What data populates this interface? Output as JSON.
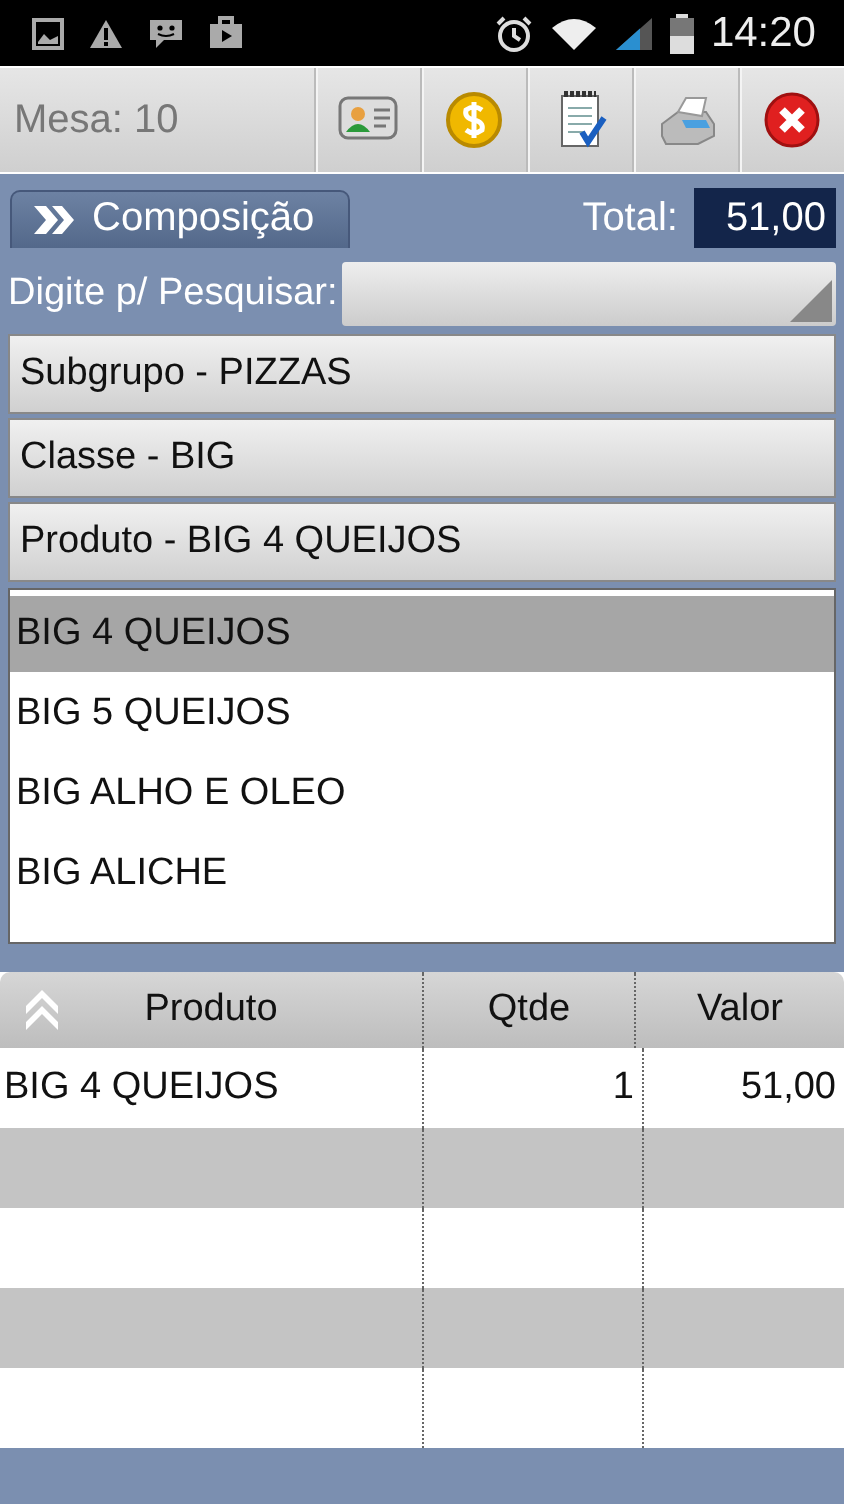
{
  "status_bar": {
    "time": "14:20"
  },
  "toolbar": {
    "title": "Mesa: 10"
  },
  "tab": {
    "label": "Composição",
    "selected": true
  },
  "total": {
    "label": "Total:",
    "value": "51,00"
  },
  "search": {
    "label": "Digite p/ Pesquisar:"
  },
  "filters": [
    {
      "label": "Subgrupo - PIZZAS"
    },
    {
      "label": "Classe - BIG"
    },
    {
      "label": "Produto - BIG 4 QUEIJOS"
    }
  ],
  "products": [
    {
      "label": "BIG 4 QUEIJOS",
      "selected": true
    },
    {
      "label": "BIG 5 QUEIJOS",
      "selected": false
    },
    {
      "label": "BIG ALHO E OLEO",
      "selected": false
    },
    {
      "label": "BIG ALICHE",
      "selected": false
    }
  ],
  "table": {
    "columns": [
      "Produto",
      "Qtde",
      "Valor"
    ],
    "rows": [
      [
        "BIG 4 QUEIJOS",
        "1",
        "51,00"
      ]
    ]
  }
}
